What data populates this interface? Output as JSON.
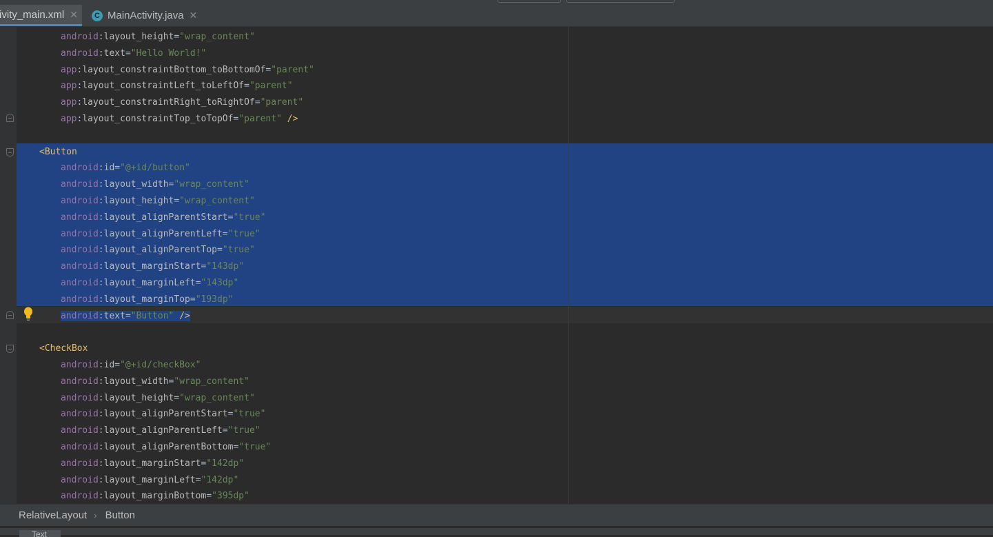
{
  "tabs": [
    {
      "label": "ivity_main.xml",
      "close": "✕",
      "active": true
    },
    {
      "label": "MainActivity.java",
      "icon": "C",
      "close": "✕",
      "active": false
    }
  ],
  "code_lines": [
    {
      "i": 2,
      "ns": "android",
      "attr": "layout_height",
      "val": "\"wrap_content\""
    },
    {
      "i": 2,
      "ns": "android",
      "attr": "text",
      "val": "\"Hello World!\""
    },
    {
      "i": 2,
      "ns": "app",
      "attr": "layout_constraintBottom_toBottomOf",
      "val": "\"parent\""
    },
    {
      "i": 2,
      "ns": "app",
      "attr": "layout_constraintLeft_toLeftOf",
      "val": "\"parent\""
    },
    {
      "i": 2,
      "ns": "app",
      "attr": "layout_constraintRight_toRightOf",
      "val": "\"parent\""
    },
    {
      "i": 2,
      "ns": "app",
      "attr": "layout_constraintTop_toTopOf",
      "val": "\"parent\"",
      "end": " />"
    },
    {
      "blank": true
    },
    {
      "i": 1,
      "tag": "<Button",
      "sel": true
    },
    {
      "i": 2,
      "ns": "android",
      "attr": "id",
      "val": "\"@+id/button\"",
      "sel": true
    },
    {
      "i": 2,
      "ns": "android",
      "attr": "layout_width",
      "val": "\"wrap_content\"",
      "sel": true
    },
    {
      "i": 2,
      "ns": "android",
      "attr": "layout_height",
      "val": "\"wrap_content\"",
      "sel": true
    },
    {
      "i": 2,
      "ns": "android",
      "attr": "layout_alignParentStart",
      "val": "\"true\"",
      "sel": true
    },
    {
      "i": 2,
      "ns": "android",
      "attr": "layout_alignParentLeft",
      "val": "\"true\"",
      "sel": true
    },
    {
      "i": 2,
      "ns": "android",
      "attr": "layout_alignParentTop",
      "val": "\"true\"",
      "sel": true
    },
    {
      "i": 2,
      "ns": "android",
      "attr": "layout_marginStart",
      "val": "\"143dp\"",
      "sel": true
    },
    {
      "i": 2,
      "ns": "android",
      "attr": "layout_marginLeft",
      "val": "\"143dp\"",
      "sel": true
    },
    {
      "i": 2,
      "ns": "android",
      "attr": "layout_marginTop",
      "val": "\"193dp\"",
      "sel": true
    },
    {
      "i": 2,
      "ns": "android",
      "attr": "text",
      "val": "\"Button\"",
      "end": " />",
      "partial": true
    },
    {
      "blank": true
    },
    {
      "i": 1,
      "tag": "<CheckBox"
    },
    {
      "i": 2,
      "ns": "android",
      "attr": "id",
      "val": "\"@+id/checkBox\""
    },
    {
      "i": 2,
      "ns": "android",
      "attr": "layout_width",
      "val": "\"wrap_content\""
    },
    {
      "i": 2,
      "ns": "android",
      "attr": "layout_height",
      "val": "\"wrap_content\""
    },
    {
      "i": 2,
      "ns": "android",
      "attr": "layout_alignParentStart",
      "val": "\"true\""
    },
    {
      "i": 2,
      "ns": "android",
      "attr": "layout_alignParentLeft",
      "val": "\"true\""
    },
    {
      "i": 2,
      "ns": "android",
      "attr": "layout_alignParentBottom",
      "val": "\"true\""
    },
    {
      "i": 2,
      "ns": "android",
      "attr": "layout_marginStart",
      "val": "\"142dp\""
    },
    {
      "i": 2,
      "ns": "android",
      "attr": "layout_marginLeft",
      "val": "\"142dp\""
    },
    {
      "i": 2,
      "ns": "android",
      "attr": "layout_marginBottom",
      "val": "\"395dp\""
    }
  ],
  "breadcrumb": {
    "items": [
      "RelativeLayout",
      "Button"
    ],
    "separator": "›"
  },
  "bottom_tab": "Text",
  "colors": {
    "editor_bg": "#2b2b2b",
    "selection": "#214283",
    "namespace": "#9876aa",
    "attribute": "#bababa",
    "string": "#6a8759",
    "tag": "#e8bf6a",
    "tab_underline": "#4a88c7"
  }
}
